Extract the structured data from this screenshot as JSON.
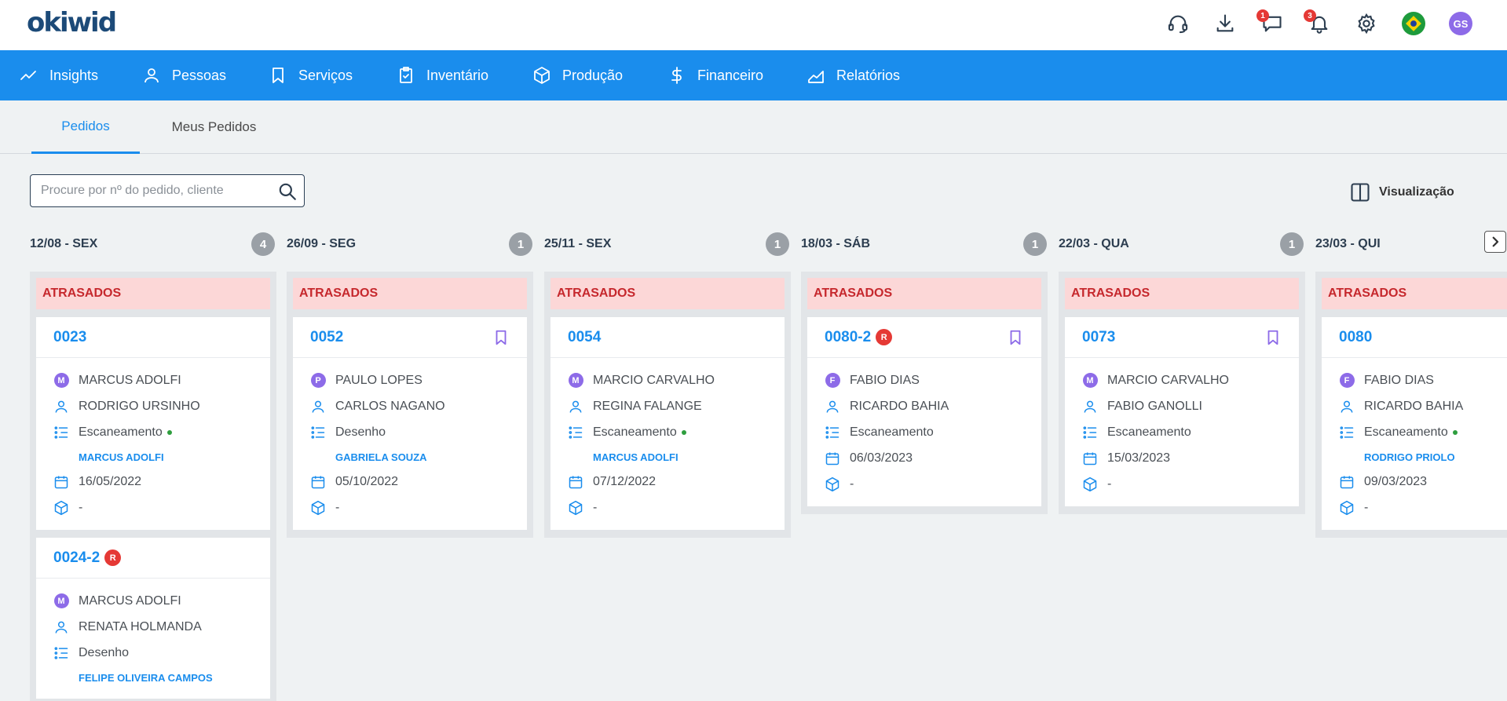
{
  "app": {
    "logo_text": "okiwid"
  },
  "header": {
    "icons": [
      {
        "name": "headset-icon"
      },
      {
        "name": "download-icon"
      },
      {
        "name": "chat-icon",
        "badge": "1"
      },
      {
        "name": "bell-icon",
        "badge": "3"
      },
      {
        "name": "gear-icon"
      },
      {
        "name": "brazil-flag-icon"
      }
    ],
    "user_initials": "GS"
  },
  "nav": {
    "items": [
      {
        "label": "Insights",
        "icon": "trending-up-icon"
      },
      {
        "label": "Pessoas",
        "icon": "person-icon"
      },
      {
        "label": "Serviços",
        "icon": "bookmark-icon"
      },
      {
        "label": "Inventário",
        "icon": "clipboard-check-icon"
      },
      {
        "label": "Produção",
        "icon": "box-icon"
      },
      {
        "label": "Financeiro",
        "icon": "dollar-icon"
      },
      {
        "label": "Relatórios",
        "icon": "chart-area-icon"
      }
    ]
  },
  "tabs": [
    {
      "label": "Pedidos",
      "active": true
    },
    {
      "label": "Meus Pedidos",
      "active": false
    }
  ],
  "search": {
    "placeholder": "Procure por nº do pedido, cliente"
  },
  "view_toggle": {
    "label": "Visualização"
  },
  "colors": {
    "accent": "#1a8ded",
    "late_bg": "#fcd7d7",
    "late_text": "#c6282d",
    "avatar": "#8d6be8",
    "status_dot": "#2e9e3e"
  },
  "columns": [
    {
      "date": "12/08 - SEX",
      "count": "4",
      "section": "ATRASADOS",
      "cards": [
        {
          "order": "0023",
          "badge": "",
          "bookmark": false,
          "client_initial": "M",
          "client": "MARCUS ADOLFI",
          "person": "RODRIGO URSINHO",
          "stage": "Escaneamento",
          "stage_dot": true,
          "assignee": "MARCUS ADOLFI",
          "date": "16/05/2022",
          "product": "-"
        },
        {
          "order": "0024-2",
          "badge": "R",
          "bookmark": false,
          "client_initial": "M",
          "client": "MARCUS ADOLFI",
          "person": "RENATA HOLMANDA",
          "stage": "Desenho",
          "stage_dot": false,
          "assignee": "FELIPE OLIVEIRA CAMPOS",
          "date": "",
          "product": ""
        }
      ]
    },
    {
      "date": "26/09 - SEG",
      "count": "1",
      "section": "ATRASADOS",
      "cards": [
        {
          "order": "0052",
          "badge": "",
          "bookmark": true,
          "client_initial": "P",
          "client": "PAULO LOPES",
          "person": "CARLOS NAGANO",
          "stage": "Desenho",
          "stage_dot": false,
          "assignee": "GABRIELA SOUZA",
          "date": "05/10/2022",
          "product": "-"
        }
      ]
    },
    {
      "date": "25/11 - SEX",
      "count": "1",
      "section": "ATRASADOS",
      "cards": [
        {
          "order": "0054",
          "badge": "",
          "bookmark": false,
          "client_initial": "M",
          "client": "MARCIO CARVALHO",
          "person": "REGINA FALANGE",
          "stage": "Escaneamento",
          "stage_dot": true,
          "assignee": "MARCUS ADOLFI",
          "date": "07/12/2022",
          "product": "-"
        }
      ]
    },
    {
      "date": "18/03 - SÁB",
      "count": "1",
      "section": "ATRASADOS",
      "cards": [
        {
          "order": "0080-2",
          "badge": "R",
          "bookmark": true,
          "client_initial": "F",
          "client": "FABIO DIAS",
          "person": "RICARDO BAHIA",
          "stage": "Escaneamento",
          "stage_dot": false,
          "assignee": "",
          "date": "06/03/2023",
          "product": "-"
        }
      ]
    },
    {
      "date": "22/03 - QUA",
      "count": "1",
      "section": "ATRASADOS",
      "cards": [
        {
          "order": "0073",
          "badge": "",
          "bookmark": true,
          "client_initial": "M",
          "client": "MARCIO CARVALHO",
          "person": "FABIO GANOLLI",
          "stage": "Escaneamento",
          "stage_dot": false,
          "assignee": "",
          "date": "15/03/2023",
          "product": "-"
        }
      ]
    },
    {
      "date": "23/03 - QUI",
      "count": "",
      "section": "ATRASADOS",
      "cards": [
        {
          "order": "0080",
          "badge": "",
          "bookmark": false,
          "client_initial": "F",
          "client": "FABIO DIAS",
          "person": "RICARDO BAHIA",
          "stage": "Escaneamento",
          "stage_dot": true,
          "assignee": "RODRIGO PRIOLO",
          "date": "09/03/2023",
          "product": "-"
        }
      ]
    }
  ]
}
